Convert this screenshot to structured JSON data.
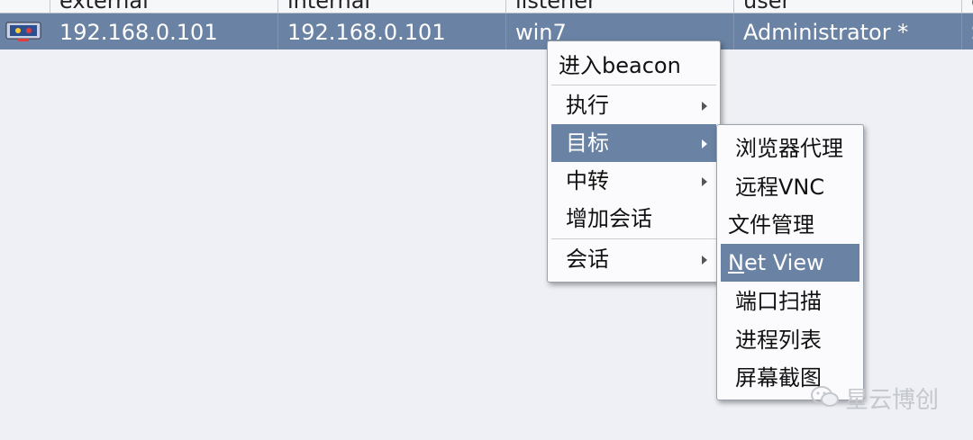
{
  "table": {
    "columns": [
      "external",
      "internal",
      "listener",
      "user",
      "c"
    ],
    "selected_row": {
      "external": "192.168.0.101",
      "internal": "192.168.0.101",
      "listener": "win7",
      "user": "Administrator *",
      "extra": "S"
    }
  },
  "context_menu": {
    "items": [
      {
        "label": "进入beacon",
        "submenu": false
      },
      {
        "label": "执行",
        "submenu": true
      },
      {
        "label": "目标",
        "submenu": true,
        "selected": true
      },
      {
        "label": "中转",
        "submenu": true
      },
      {
        "label": "增加会话",
        "submenu": false
      },
      {
        "label": "会话",
        "submenu": true
      }
    ]
  },
  "submenu": {
    "items": [
      {
        "label": "浏览器代理"
      },
      {
        "label": "远程VNC"
      },
      {
        "label": "文件管理"
      },
      {
        "label": "Net View",
        "mnemonic": "N",
        "rest": "et View",
        "selected": true
      },
      {
        "label": "端口扫描"
      },
      {
        "label": "进程列表"
      },
      {
        "label": "屏幕截图"
      }
    ]
  },
  "watermark": {
    "text": "星云博创"
  },
  "colors": {
    "selection": "#6a82a3",
    "background": "#eef0f5"
  }
}
